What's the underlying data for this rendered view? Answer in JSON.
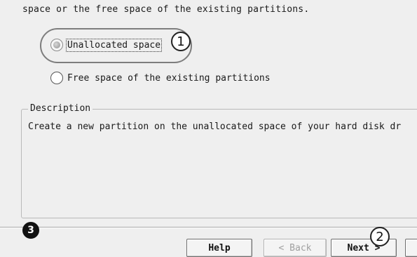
{
  "wizard": {
    "intro_text": "space or the free space of the existing partitions.",
    "options": [
      {
        "label": "Unallocated space",
        "selected": true
      },
      {
        "label": "Free space of the existing partitions",
        "selected": false
      }
    ],
    "description": {
      "legend": "Description",
      "text": "Create a new partition on the unallocated space of your hard disk dr"
    }
  },
  "callouts": {
    "one": "1",
    "two": "2",
    "three": "3"
  },
  "buttons": {
    "help": "Help",
    "back": "< Back",
    "next": "Next >"
  }
}
